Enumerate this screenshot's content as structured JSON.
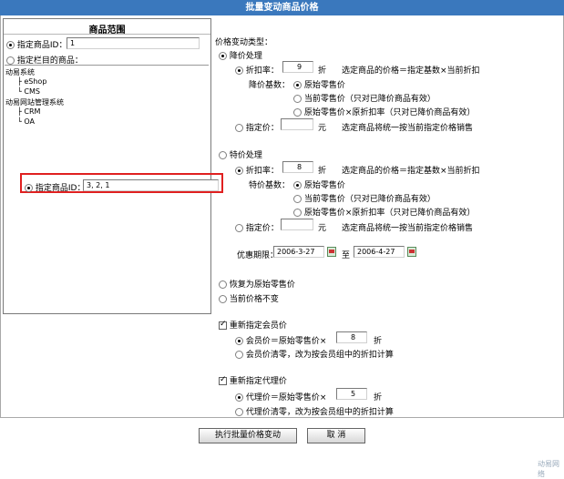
{
  "title": "批量变动商品价格",
  "left": {
    "title": "商品范围",
    "opt_id_label": "指定商品ID：",
    "opt_id_value": "1",
    "opt_cat_label": "指定栏目的商品：",
    "tree": [
      {
        "text": "动易系统",
        "indent": 0
      },
      {
        "text": "├ eShop",
        "indent": 1
      },
      {
        "text": "└ CMS",
        "indent": 1
      },
      {
        "text": "动易网站管理系统",
        "indent": 0
      },
      {
        "text": "├ CRM",
        "indent": 1
      },
      {
        "text": "└ OA",
        "indent": 1
      }
    ],
    "highlight_label": "指定商品ID：",
    "highlight_value": "3, 2, 1"
  },
  "right": {
    "type_label": "价格变动类型：",
    "down": {
      "label": "降价处理",
      "discount_label": "折扣率：",
      "discount_value": "9",
      "discount_unit": "折",
      "discount_formula": "选定商品的价格＝指定基数×当前折扣",
      "base_label": "降价基数：",
      "base_opts": [
        "原始零售价",
        "当前零售价（只对已降价商品有效）",
        "原始零售价×原折扣率（只对已降价商品有效）"
      ],
      "fixed_label": "指定价：",
      "fixed_value": "",
      "fixed_unit": "元",
      "fixed_desc": "选定商品将统一按当前指定价格销售"
    },
    "special": {
      "label": "特价处理",
      "discount_label": "折扣率：",
      "discount_value": "8",
      "discount_unit": "折",
      "discount_formula": "选定商品的价格＝指定基数×当前折扣",
      "base_label": "特价基数：",
      "base_opts": [
        "原始零售价",
        "当前零售价（只对已降价商品有效）",
        "原始零售价×原折扣率（只对已降价商品有效）"
      ],
      "fixed_label": "指定价：",
      "fixed_value": "",
      "fixed_unit": "元",
      "fixed_desc": "选定商品将统一按当前指定价格销售",
      "period_label": "优惠期限：",
      "start": "2006-3-27",
      "to": "至",
      "end": "2006-4-27"
    },
    "restore_label": "恢复为原始零售价",
    "keep_label": "当前价格不变",
    "member": {
      "label": "重新指定会员价",
      "opt1_prefix": "会员价＝原始零售价×",
      "opt1_value": "8",
      "opt1_unit": "折",
      "opt2": "会员价清零，改为按会员组中的折扣计算"
    },
    "agent": {
      "label": "重新指定代理价",
      "opt1_prefix": "代理价＝原始零售价×",
      "opt1_value": "5",
      "opt1_unit": "折",
      "opt2": "代理价清零，改为按会员组中的折扣计算"
    }
  },
  "buttons": {
    "execute": "执行批量价格变动",
    "cancel": "取 消"
  },
  "footer": "动易网络"
}
